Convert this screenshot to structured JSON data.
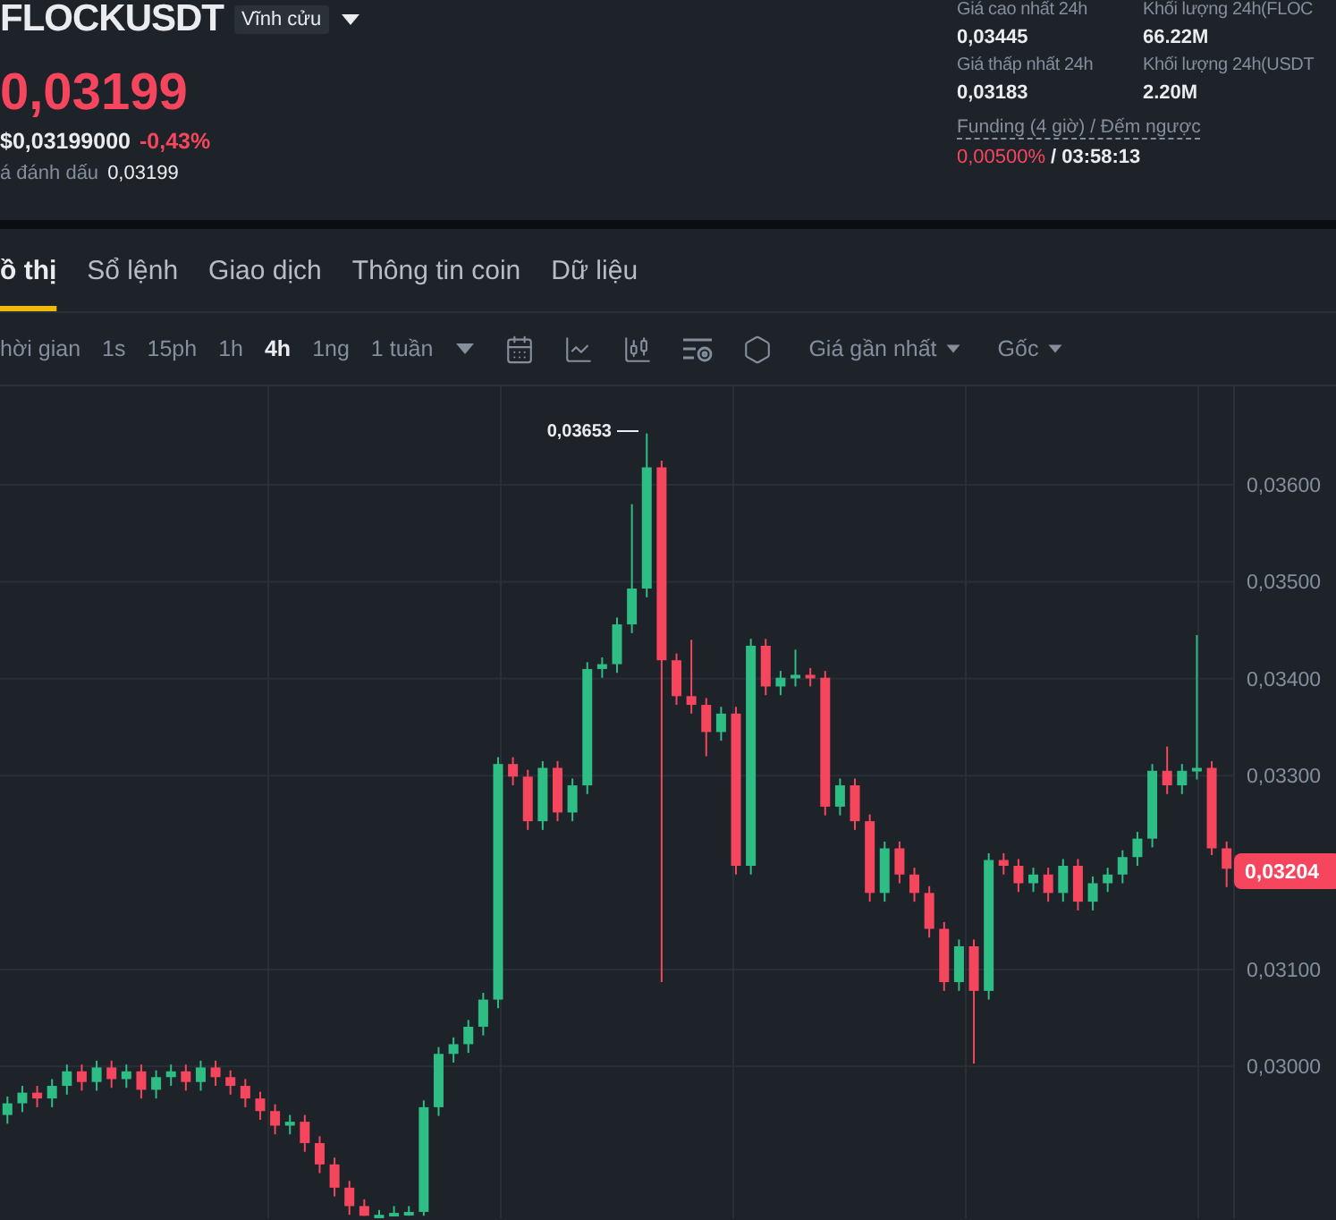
{
  "symbol": {
    "name": "FLOCKUSDT",
    "badge": "Vĩnh cửu"
  },
  "price": {
    "last": "0,03199",
    "usd": "$0,03199000",
    "change": "-0,43%",
    "mark_label": "á đánh dấu",
    "mark_value": "0,03199"
  },
  "stats": [
    {
      "label": "Giá cao nhất 24h",
      "value": "0,03445"
    },
    {
      "label": "Khối lượng 24h(FLOC",
      "value": "66.22M"
    },
    {
      "label": "Giá thấp nhất 24h",
      "value": "0,03183"
    },
    {
      "label": "Khối lượng 24h(USDT",
      "value": "2.20M"
    }
  ],
  "funding": {
    "label": "Funding (4 giờ) / Đếm ngược",
    "rate": "0,00500%",
    "separator": "/",
    "countdown": "03:58:13"
  },
  "tabs": [
    {
      "label": "ồ thị",
      "selected": true
    },
    {
      "label": "Sổ lệnh",
      "selected": false
    },
    {
      "label": "Giao dịch",
      "selected": false
    },
    {
      "label": "Thông tin coin",
      "selected": false
    },
    {
      "label": "Dữ liệu",
      "selected": false
    }
  ],
  "toolbar": {
    "time_label": "hời gian",
    "intervals": [
      {
        "label": "1s",
        "selected": false
      },
      {
        "label": "15ph",
        "selected": false
      },
      {
        "label": "1h",
        "selected": false
      },
      {
        "label": "4h",
        "selected": true
      },
      {
        "label": "1ng",
        "selected": false
      },
      {
        "label": "1 tuần",
        "selected": false
      }
    ],
    "price_type": "Giá gần nhất",
    "scale": "Gốc"
  },
  "chart": {
    "peak_label": "0,03653",
    "last_price": "0,03204",
    "chart_data": {
      "type": "candlestick",
      "categories": [
        null,
        null,
        null,
        null,
        null,
        null,
        null,
        null,
        null,
        null,
        null,
        null,
        null,
        null,
        null,
        null,
        null,
        null,
        null,
        null,
        null,
        null,
        null,
        null,
        null,
        null,
        null,
        null,
        null,
        null,
        null,
        null,
        null,
        null,
        null,
        null,
        null,
        null,
        null,
        null,
        null,
        null,
        null,
        null,
        null,
        null,
        null,
        null,
        null,
        null,
        null,
        null,
        null,
        null,
        null,
        null,
        null,
        null,
        null,
        null,
        null,
        null,
        null,
        null,
        null,
        null,
        null,
        null,
        null,
        null,
        null,
        null,
        null,
        null,
        null,
        null,
        null,
        null,
        null,
        null,
        null,
        null,
        null
      ],
      "grid": true,
      "ylim": [
        0.028435,
        0.037015
      ],
      "yticks": [
        {
          "value": 0.036,
          "label": "0,03600"
        },
        {
          "value": 0.035,
          "label": "0,03500"
        },
        {
          "value": 0.034,
          "label": "0,03400"
        },
        {
          "value": 0.033,
          "label": "0,03300"
        },
        {
          "value": 0.031,
          "label": "0,03100"
        },
        {
          "value": 0.03,
          "label": "0,03000"
        }
      ],
      "ohlc": [
        [
          0.0295,
          0.02969,
          0.02941,
          0.02962
        ],
        [
          0.02962,
          0.0298,
          0.02953,
          0.02973
        ],
        [
          0.02973,
          0.0298,
          0.02958,
          0.02967
        ],
        [
          0.02967,
          0.02987,
          0.02958,
          0.0298
        ],
        [
          0.0298,
          0.03002,
          0.02971,
          0.02995
        ],
        [
          0.02995,
          0.03002,
          0.02975,
          0.02984
        ],
        [
          0.02984,
          0.03006,
          0.02975,
          0.02999
        ],
        [
          0.02999,
          0.03006,
          0.02978,
          0.02987
        ],
        [
          0.02987,
          0.03002,
          0.02978,
          0.02995
        ],
        [
          0.02995,
          0.03002,
          0.02967,
          0.02976
        ],
        [
          0.02976,
          0.02996,
          0.02967,
          0.02989
        ],
        [
          0.02989,
          0.03002,
          0.0298,
          0.02995
        ],
        [
          0.02995,
          0.03002,
          0.02975,
          0.02984
        ],
        [
          0.02984,
          0.03006,
          0.02975,
          0.02999
        ],
        [
          0.02999,
          0.03006,
          0.0298,
          0.02989
        ],
        [
          0.02989,
          0.02996,
          0.02971,
          0.0298
        ],
        [
          0.0298,
          0.02987,
          0.02958,
          0.02967
        ],
        [
          0.02967,
          0.02974,
          0.02945,
          0.02954
        ],
        [
          0.02954,
          0.02961,
          0.0293,
          0.02939
        ],
        [
          0.02939,
          0.0295,
          0.0293,
          0.02943
        ],
        [
          0.02943,
          0.0295,
          0.02912,
          0.02921
        ],
        [
          0.02921,
          0.02928,
          0.0289,
          0.02899
        ],
        [
          0.02899,
          0.02906,
          0.02866,
          0.02875
        ],
        [
          0.02875,
          0.02882,
          0.02847,
          0.02856
        ],
        [
          0.02856,
          0.02863,
          0.02846,
          0.02846
        ],
        [
          0.02846,
          0.02852,
          0.02846,
          0.02847
        ],
        [
          0.02847,
          0.02856,
          0.02846,
          0.02849
        ],
        [
          0.02849,
          0.02856,
          0.02846,
          0.0285
        ],
        [
          0.0285,
          0.02965,
          0.02846,
          0.02958
        ],
        [
          0.02958,
          0.0302,
          0.02949,
          0.03013
        ],
        [
          0.03013,
          0.0303,
          0.03004,
          0.03023
        ],
        [
          0.03023,
          0.03048,
          0.03014,
          0.03041
        ],
        [
          0.03041,
          0.03076,
          0.03032,
          0.03069
        ],
        [
          0.03069,
          0.03319,
          0.0306,
          0.03312
        ],
        [
          0.03312,
          0.03319,
          0.0329,
          0.03299
        ],
        [
          0.03299,
          0.03306,
          0.03244,
          0.03253
        ],
        [
          0.03253,
          0.03315,
          0.03244,
          0.03308
        ],
        [
          0.03308,
          0.03315,
          0.03253,
          0.03262
        ],
        [
          0.03262,
          0.03297,
          0.03253,
          0.0329
        ],
        [
          0.0329,
          0.03417,
          0.03281,
          0.0341
        ],
        [
          0.0341,
          0.03422,
          0.03401,
          0.03415
        ],
        [
          0.03415,
          0.03463,
          0.03406,
          0.03456
        ],
        [
          0.03456,
          0.0358,
          0.03447,
          0.03493
        ],
        [
          0.03493,
          0.03653,
          0.03484,
          0.03618
        ],
        [
          0.03618,
          0.03625,
          0.03087,
          0.03419
        ],
        [
          0.03419,
          0.03426,
          0.03373,
          0.03382
        ],
        [
          0.03382,
          0.0344,
          0.03364,
          0.03373
        ],
        [
          0.03373,
          0.0338,
          0.0332,
          0.03345
        ],
        [
          0.03345,
          0.03371,
          0.03336,
          0.03364
        ],
        [
          0.03364,
          0.03371,
          0.03198,
          0.03207
        ],
        [
          0.03207,
          0.03441,
          0.03198,
          0.03434
        ],
        [
          0.03434,
          0.03441,
          0.03383,
          0.03392
        ],
        [
          0.03392,
          0.03408,
          0.03383,
          0.03401
        ],
        [
          0.03401,
          0.0343,
          0.03392,
          0.03404
        ],
        [
          0.03404,
          0.03411,
          0.03392,
          0.03401
        ],
        [
          0.03401,
          0.03408,
          0.03259,
          0.03268
        ],
        [
          0.03268,
          0.03297,
          0.03259,
          0.0329
        ],
        [
          0.0329,
          0.03297,
          0.03244,
          0.03253
        ],
        [
          0.03253,
          0.0326,
          0.0317,
          0.03179
        ],
        [
          0.03179,
          0.03232,
          0.0317,
          0.03225
        ],
        [
          0.03225,
          0.03232,
          0.03189,
          0.03198
        ],
        [
          0.03198,
          0.03205,
          0.0317,
          0.03179
        ],
        [
          0.03179,
          0.03186,
          0.03133,
          0.03142
        ],
        [
          0.03142,
          0.03149,
          0.03078,
          0.03087
        ],
        [
          0.03087,
          0.03131,
          0.03078,
          0.03124
        ],
        [
          0.03124,
          0.03131,
          0.03003,
          0.03078
        ],
        [
          0.03078,
          0.0322,
          0.03069,
          0.03213
        ],
        [
          0.03213,
          0.0322,
          0.03198,
          0.03207
        ],
        [
          0.03207,
          0.03214,
          0.0318,
          0.03189
        ],
        [
          0.03189,
          0.03205,
          0.0318,
          0.03198
        ],
        [
          0.03198,
          0.03205,
          0.0317,
          0.03179
        ],
        [
          0.03179,
          0.03214,
          0.0317,
          0.03207
        ],
        [
          0.03207,
          0.03214,
          0.03161,
          0.0317
        ],
        [
          0.0317,
          0.03196,
          0.03161,
          0.03189
        ],
        [
          0.03189,
          0.03205,
          0.0318,
          0.03198
        ],
        [
          0.03198,
          0.03223,
          0.03189,
          0.03216
        ],
        [
          0.03216,
          0.03242,
          0.03207,
          0.03235
        ],
        [
          0.03235,
          0.03312,
          0.03226,
          0.03305
        ],
        [
          0.03305,
          0.0333,
          0.03281,
          0.0329
        ],
        [
          0.0329,
          0.03312,
          0.03281,
          0.03305
        ],
        [
          0.03305,
          0.03445,
          0.03296,
          0.03308
        ],
        [
          0.03308,
          0.03315,
          0.03218,
          0.03225
        ],
        [
          0.03225,
          0.03232,
          0.03185,
          0.03204
        ]
      ]
    }
  }
}
